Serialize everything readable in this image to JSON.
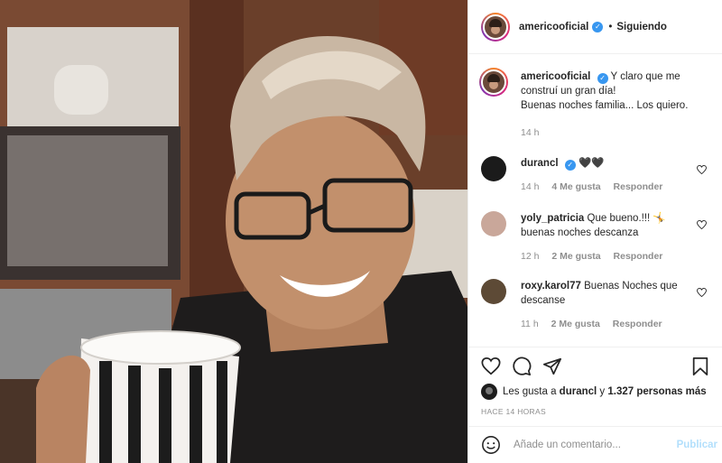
{
  "post": {
    "username": "americooficial",
    "follow_status": "Siguiendo",
    "caption_line1": "Y claro que me construí un gran día!",
    "caption_line2": "Buenas noches familia... Los quiero.",
    "caption_age": "14 h"
  },
  "comments": [
    {
      "user": "durancl",
      "text": "🖤🖤",
      "age": "14 h",
      "likes": "4 Me gusta",
      "reply": "Responder",
      "avatar_color": "#1b1b1b"
    },
    {
      "user": "yoly_patricia",
      "text": "Que bueno.!!! 🤸 buenas noches descanza",
      "age": "12 h",
      "likes": "2 Me gusta",
      "reply": "Responder",
      "avatar_color": "#c9a79a"
    },
    {
      "user": "roxy.karol77",
      "text": "Buenas Noches que descanse",
      "age": "11 h",
      "likes": "2 Me gusta",
      "reply": "Responder",
      "avatar_color": "#5d4a36"
    }
  ],
  "likes": {
    "prefix": "Les gusta a",
    "user": "durancl",
    "connector": "y",
    "count": "1.327 personas más"
  },
  "timestamp": "HACE 14 HORAS",
  "composer": {
    "placeholder": "Añade un comentario...",
    "publish_label": "Publicar"
  },
  "colors": {
    "verified": "#3897f0",
    "publish_disabled": "#b2dffc",
    "muted_text": "#8e8e8e"
  },
  "icons": [
    "heart-icon",
    "comment-icon",
    "share-icon",
    "bookmark-icon",
    "emoji-icon"
  ]
}
